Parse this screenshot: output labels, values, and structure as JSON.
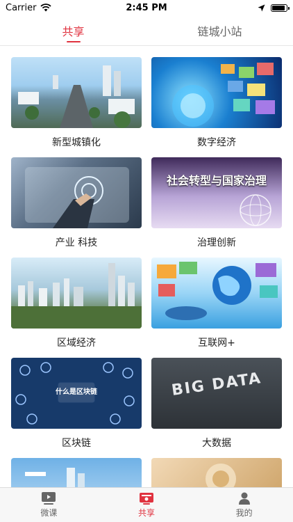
{
  "status": {
    "carrier": "Carrier",
    "time": "2:45 PM",
    "battery_level": 0.9
  },
  "top_tabs": [
    {
      "label": "共享",
      "active": true
    },
    {
      "label": "链城小站",
      "active": false
    }
  ],
  "cards": [
    {
      "label": "新型城镇化",
      "image": "urbanization"
    },
    {
      "label": "数字经济",
      "image": "digital-economy"
    },
    {
      "label": "产业 科技",
      "image": "industry-tech"
    },
    {
      "label": "治理创新",
      "image": "society-governance",
      "image_text": "社会转型与国家治理"
    },
    {
      "label": "区域经济",
      "image": "regional-economy"
    },
    {
      "label": "互联网+",
      "image": "internet-plus"
    },
    {
      "label": "区块链",
      "image": "blockchain",
      "image_text": "什么是区块链"
    },
    {
      "label": "大数据",
      "image": "big-data",
      "image_text": "BIG DATA"
    },
    {
      "label": "",
      "image": "city-partial"
    },
    {
      "label": "",
      "image": "gold-partial"
    }
  ],
  "bottom_tabs": [
    {
      "label": "微课",
      "icon": "video-icon",
      "active": false
    },
    {
      "label": "共享",
      "icon": "share-icon",
      "active": true
    },
    {
      "label": "我的",
      "icon": "person-icon",
      "active": false
    }
  ],
  "colors": {
    "accent": "#e0323f",
    "inactive": "#666666"
  }
}
